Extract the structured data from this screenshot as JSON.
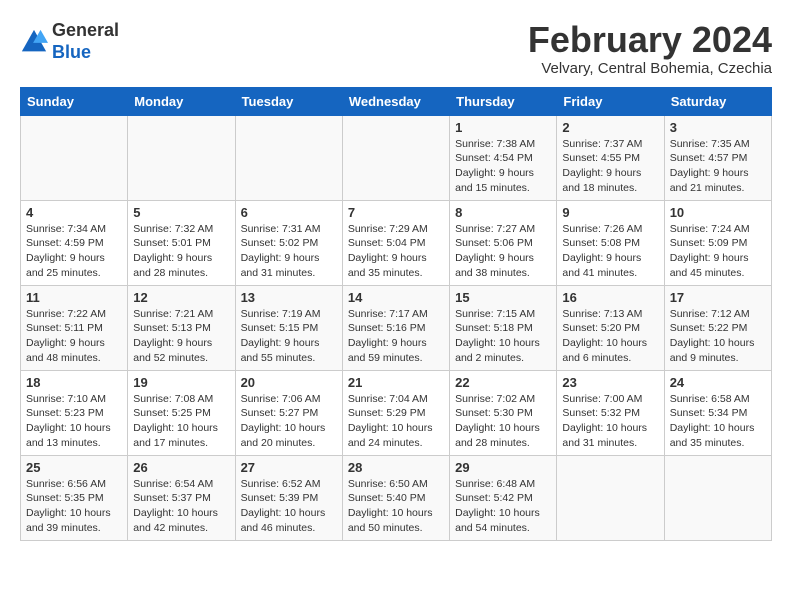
{
  "header": {
    "logo_general": "General",
    "logo_blue": "Blue",
    "month_year": "February 2024",
    "location": "Velvary, Central Bohemia, Czechia"
  },
  "weekdays": [
    "Sunday",
    "Monday",
    "Tuesday",
    "Wednesday",
    "Thursday",
    "Friday",
    "Saturday"
  ],
  "weeks": [
    [
      {
        "day": "",
        "info": ""
      },
      {
        "day": "",
        "info": ""
      },
      {
        "day": "",
        "info": ""
      },
      {
        "day": "",
        "info": ""
      },
      {
        "day": "1",
        "info": "Sunrise: 7:38 AM\nSunset: 4:54 PM\nDaylight: 9 hours\nand 15 minutes."
      },
      {
        "day": "2",
        "info": "Sunrise: 7:37 AM\nSunset: 4:55 PM\nDaylight: 9 hours\nand 18 minutes."
      },
      {
        "day": "3",
        "info": "Sunrise: 7:35 AM\nSunset: 4:57 PM\nDaylight: 9 hours\nand 21 minutes."
      }
    ],
    [
      {
        "day": "4",
        "info": "Sunrise: 7:34 AM\nSunset: 4:59 PM\nDaylight: 9 hours\nand 25 minutes."
      },
      {
        "day": "5",
        "info": "Sunrise: 7:32 AM\nSunset: 5:01 PM\nDaylight: 9 hours\nand 28 minutes."
      },
      {
        "day": "6",
        "info": "Sunrise: 7:31 AM\nSunset: 5:02 PM\nDaylight: 9 hours\nand 31 minutes."
      },
      {
        "day": "7",
        "info": "Sunrise: 7:29 AM\nSunset: 5:04 PM\nDaylight: 9 hours\nand 35 minutes."
      },
      {
        "day": "8",
        "info": "Sunrise: 7:27 AM\nSunset: 5:06 PM\nDaylight: 9 hours\nand 38 minutes."
      },
      {
        "day": "9",
        "info": "Sunrise: 7:26 AM\nSunset: 5:08 PM\nDaylight: 9 hours\nand 41 minutes."
      },
      {
        "day": "10",
        "info": "Sunrise: 7:24 AM\nSunset: 5:09 PM\nDaylight: 9 hours\nand 45 minutes."
      }
    ],
    [
      {
        "day": "11",
        "info": "Sunrise: 7:22 AM\nSunset: 5:11 PM\nDaylight: 9 hours\nand 48 minutes."
      },
      {
        "day": "12",
        "info": "Sunrise: 7:21 AM\nSunset: 5:13 PM\nDaylight: 9 hours\nand 52 minutes."
      },
      {
        "day": "13",
        "info": "Sunrise: 7:19 AM\nSunset: 5:15 PM\nDaylight: 9 hours\nand 55 minutes."
      },
      {
        "day": "14",
        "info": "Sunrise: 7:17 AM\nSunset: 5:16 PM\nDaylight: 9 hours\nand 59 minutes."
      },
      {
        "day": "15",
        "info": "Sunrise: 7:15 AM\nSunset: 5:18 PM\nDaylight: 10 hours\nand 2 minutes."
      },
      {
        "day": "16",
        "info": "Sunrise: 7:13 AM\nSunset: 5:20 PM\nDaylight: 10 hours\nand 6 minutes."
      },
      {
        "day": "17",
        "info": "Sunrise: 7:12 AM\nSunset: 5:22 PM\nDaylight: 10 hours\nand 9 minutes."
      }
    ],
    [
      {
        "day": "18",
        "info": "Sunrise: 7:10 AM\nSunset: 5:23 PM\nDaylight: 10 hours\nand 13 minutes."
      },
      {
        "day": "19",
        "info": "Sunrise: 7:08 AM\nSunset: 5:25 PM\nDaylight: 10 hours\nand 17 minutes."
      },
      {
        "day": "20",
        "info": "Sunrise: 7:06 AM\nSunset: 5:27 PM\nDaylight: 10 hours\nand 20 minutes."
      },
      {
        "day": "21",
        "info": "Sunrise: 7:04 AM\nSunset: 5:29 PM\nDaylight: 10 hours\nand 24 minutes."
      },
      {
        "day": "22",
        "info": "Sunrise: 7:02 AM\nSunset: 5:30 PM\nDaylight: 10 hours\nand 28 minutes."
      },
      {
        "day": "23",
        "info": "Sunrise: 7:00 AM\nSunset: 5:32 PM\nDaylight: 10 hours\nand 31 minutes."
      },
      {
        "day": "24",
        "info": "Sunrise: 6:58 AM\nSunset: 5:34 PM\nDaylight: 10 hours\nand 35 minutes."
      }
    ],
    [
      {
        "day": "25",
        "info": "Sunrise: 6:56 AM\nSunset: 5:35 PM\nDaylight: 10 hours\nand 39 minutes."
      },
      {
        "day": "26",
        "info": "Sunrise: 6:54 AM\nSunset: 5:37 PM\nDaylight: 10 hours\nand 42 minutes."
      },
      {
        "day": "27",
        "info": "Sunrise: 6:52 AM\nSunset: 5:39 PM\nDaylight: 10 hours\nand 46 minutes."
      },
      {
        "day": "28",
        "info": "Sunrise: 6:50 AM\nSunset: 5:40 PM\nDaylight: 10 hours\nand 50 minutes."
      },
      {
        "day": "29",
        "info": "Sunrise: 6:48 AM\nSunset: 5:42 PM\nDaylight: 10 hours\nand 54 minutes."
      },
      {
        "day": "",
        "info": ""
      },
      {
        "day": "",
        "info": ""
      }
    ]
  ]
}
